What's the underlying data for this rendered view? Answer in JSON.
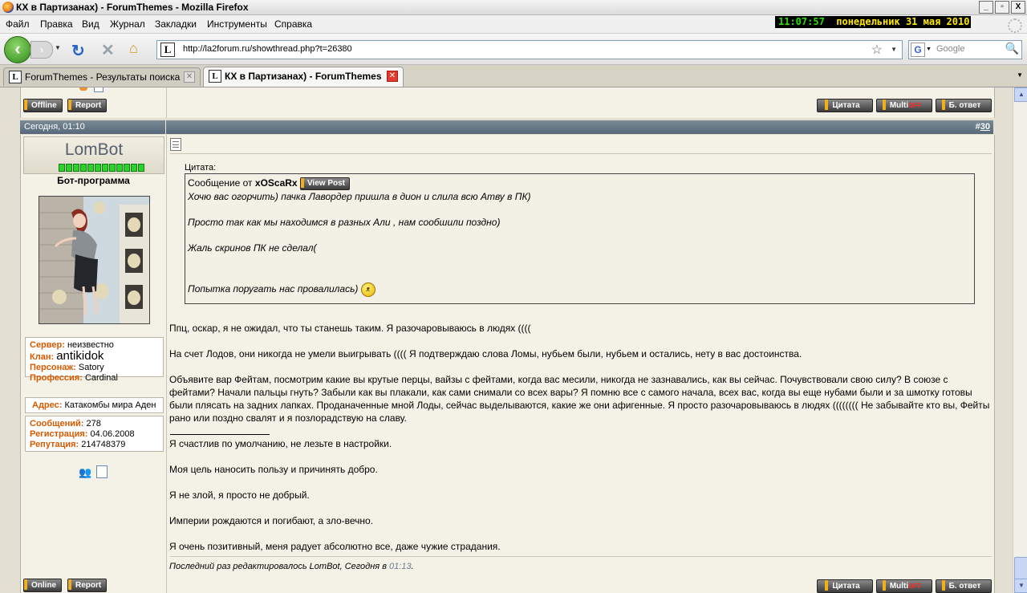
{
  "window": {
    "title": "КХ в Партизанах) - ForumThemes - Mozilla Firefox",
    "buttons": [
      "_",
      "▫",
      "X"
    ]
  },
  "menu": [
    "Файл",
    "Правка",
    "Вид",
    "Журнал",
    "Закладки",
    "Инструменты",
    "Справка"
  ],
  "clock": {
    "time": "11:07:57",
    "date": "понедельник 31 мая 2010"
  },
  "nav": {
    "url": "http://la2forum.ru/showthread.php?t=26380",
    "search_placeholder": "Google",
    "search_engine_letter": "G",
    "favicon_letter": "L"
  },
  "tabs": [
    {
      "label": "ForumThemes - Результаты поиска",
      "active": false
    },
    {
      "label": "КХ в Партизанах) - ForumThemes",
      "active": true
    }
  ],
  "prev_post": {
    "offline_label": "Offline",
    "report_label": "Report",
    "quote_label": "Цитата",
    "multi_label": "Multi",
    "multi_state": "OFF",
    "reply_label": "Б. ответ"
  },
  "post": {
    "date": "Сегодня, 01:10",
    "number_prefix": "#",
    "number": "30",
    "user": {
      "name": "LomBot",
      "title": "Бот-программа",
      "reputation_pips": 12,
      "server_label": "Сервер:",
      "server": "неизвестно",
      "clan_label": "Клан:",
      "clan": "antikidok",
      "char_label": "Персонаж:",
      "char": "Satory",
      "prof_label": "Профессия:",
      "prof": "Cardinal",
      "address_label": "Адрес:",
      "address": "Катакомбы мира Аден",
      "posts_label": "Сообщений:",
      "posts": "278",
      "reg_label": "Регистрация:",
      "reg": "04.06.2008",
      "rep_label": "Репутация:",
      "rep": "214748379"
    },
    "quote": {
      "label": "Цитата:",
      "from_prefix": "Сообщение от",
      "author": "xOScaRx",
      "view_post": "View Post",
      "lines": [
        "Хочю вас огорчить) пачка Лавордер пришла в дион и слила всю Атву в ПК)",
        "Просто так как мы находимся в разных Али , нам сообшили поздно)",
        "Жаль скринов ПК не сделал(",
        "Попытка поругать нас провалилась)"
      ]
    },
    "body": [
      "Ппц, оскар, я не ожидал, что ты станешь таким. Я разочаровываюсь в людях ((((",
      "На счет Лодов, они никогда не умели выигрывать (((( Я подтверждаю слова Ломы, нубьем были, нубьем и остались, нету в вас достоинства.",
      "Объявите вар Фейтам, посмотрим какие вы крутые перцы, вайзы с фейтами, когда вас месили, никогда не зазнавались, как вы сейчас. Почувствовали свою силу? В союзе с фейтами? Начали пальцы гнуть? Забыли как вы плакали, как сами снимали со всех вары? Я помню все с самого начала, всех вас, когда вы еще нубами были и за шмотку готовы были плясать на задних лапках. Проданаченные мной Лоды, сейчас выделываются, какие же они афигенные. Я просто разочаровываюсь в людях (((((((( Не забывайте кто вы, Фейты рано или поздно свалят и я позлорадствую на славу."
    ],
    "signature": [
      "Я счастлив по умолчанию, не лезьте в настройки.",
      "Моя цель наносить пользу и причинять добро.",
      "Я не злой, я просто не добрый.",
      "Империи рождаются и погибают, а зло-вечно.",
      "Я очень позитивный, меня радует абсолютно все, даже чужие страдания."
    ],
    "edited_prefix": "Последний раз редактировалось LomBot, Сегодня в",
    "edited_time": "01:13",
    "edited_suffix": ".",
    "online_label": "Online",
    "report_label": "Report",
    "quote_label": "Цитата",
    "multi_label": "Multi",
    "multi_state": "OFF",
    "reply_label": "Б. ответ"
  }
}
